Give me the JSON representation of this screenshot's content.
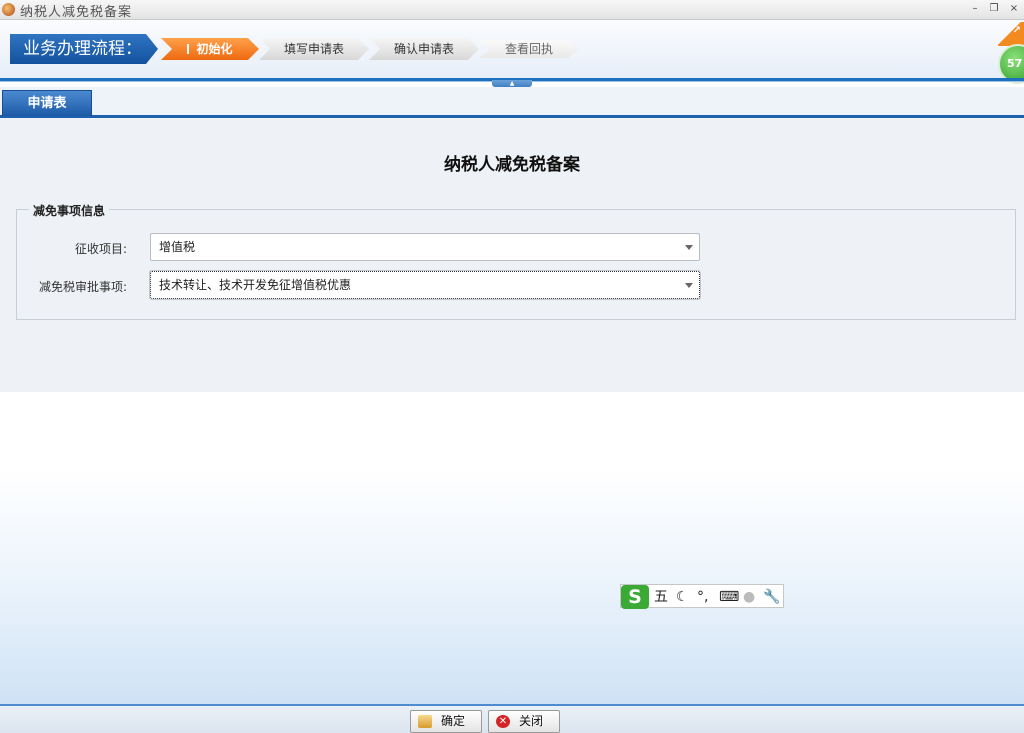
{
  "window": {
    "title": "纳税人减免税备案",
    "minimize": "–",
    "restore": "❐",
    "close": "×"
  },
  "workflow": {
    "label": "业务办理流程：",
    "steps": [
      {
        "label": "初始化",
        "state": "active"
      },
      {
        "label": "填写申请表",
        "state": "pending"
      },
      {
        "label": "确认申请表",
        "state": "pending"
      },
      {
        "label": "查看回执",
        "state": "faded"
      }
    ],
    "badge": "57"
  },
  "tabs": [
    {
      "label": "申请表",
      "active": true
    }
  ],
  "form": {
    "title": "纳税人减免税备案",
    "section_title": "减免事项信息",
    "fields": [
      {
        "label": "征收项目:",
        "value": "增值税"
      },
      {
        "label": "减免税审批事项:",
        "value": "技术转让、技术开发免征增值税优惠"
      }
    ]
  },
  "ime": {
    "logo": "S",
    "mode": "五",
    "moon": "☾",
    "punct": "°,",
    "keyboard": "⌨",
    "user": "●",
    "tool": "🔧"
  },
  "buttons": {
    "confirm": "确定",
    "close": "关闭"
  },
  "colors": {
    "accent_blue": "#1e5fae",
    "active_step": "#ee6a10",
    "ime_green": "#3aaa35",
    "close_red": "#d32525"
  }
}
